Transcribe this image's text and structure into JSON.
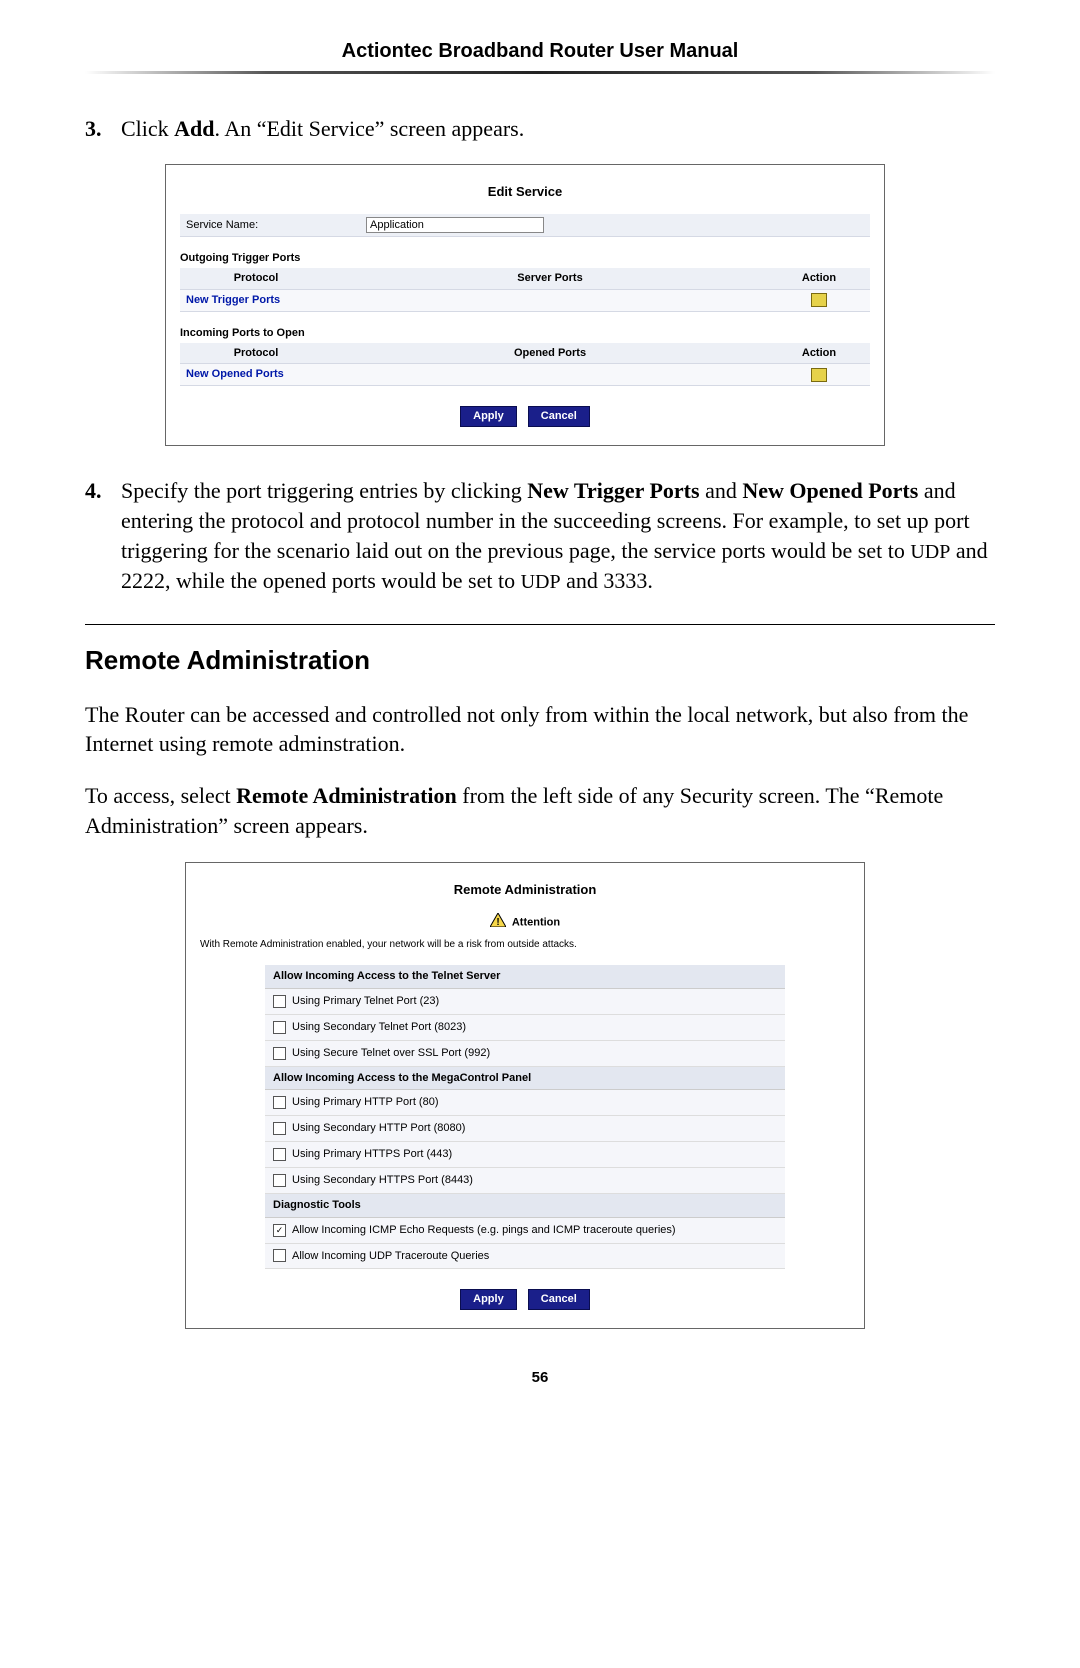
{
  "header": {
    "title": "Actiontec Broadband Router User Manual"
  },
  "step3": {
    "num": "3.",
    "pre": "Click ",
    "bold": "Add",
    "post": ". An “Edit Service” screen appears."
  },
  "editService": {
    "title": "Edit Service",
    "serviceNameLabel": "Service Name:",
    "serviceNameValue": "Application",
    "outgoingHeading": "Outgoing Trigger Ports",
    "colProtocol": "Protocol",
    "colServerPorts": "Server Ports",
    "colAction": "Action",
    "newTriggerPorts": "New Trigger Ports",
    "incomingHeading": "Incoming Ports to Open",
    "colOpenedPorts": "Opened Ports",
    "newOpenedPorts": "New Opened Ports",
    "applyLabel": "Apply",
    "cancelLabel": "Cancel"
  },
  "step4": {
    "num": "4.",
    "t1": "Specify the port triggering entries by clicking ",
    "b1": "New Trigger Ports",
    "t2": " and ",
    "b2": "New Opened Ports",
    "t3": " and entering the protocol and protocol number in the succeeding screens. For example, to set up port triggering for the scenario laid out on the previous page, the service ports would be set to ",
    "sc1": "UDP",
    "t4": " and 2222, while the opened ports would be set to ",
    "sc2": "UDP",
    "t5": " and 3333."
  },
  "remoteAdmin": {
    "heading": "Remote Administration",
    "p1": "The Router can be accessed and controlled not only from within the local network, but also from the Internet using remote adminstration.",
    "p2a": "To access, select ",
    "p2b": "Remote Administration",
    "p2c": " from the left side of any Security screen. The “Remote Administration” screen appears."
  },
  "remoteAdminSS": {
    "title": "Remote Administration",
    "attention": "Attention",
    "warn": "With Remote Administration enabled, your network will be a risk from outside attacks.",
    "h1": "Allow Incoming Access to the Telnet Server",
    "r1": "Using Primary Telnet Port (23)",
    "r2": "Using Secondary Telnet Port (8023)",
    "r3": "Using Secure Telnet over SSL Port (992)",
    "h2": "Allow Incoming Access to the MegaControl Panel",
    "r4": "Using Primary HTTP Port (80)",
    "r5": "Using Secondary HTTP Port (8080)",
    "r6": "Using Primary HTTPS Port (443)",
    "r7": "Using Secondary HTTPS Port (8443)",
    "h3": "Diagnostic Tools",
    "r8": "Allow Incoming ICMP Echo Requests (e.g. pings and ICMP traceroute queries)",
    "r8checked": true,
    "r9": "Allow Incoming UDP Traceroute Queries",
    "applyLabel": "Apply",
    "cancelLabel": "Cancel"
  },
  "pageNum": "56"
}
